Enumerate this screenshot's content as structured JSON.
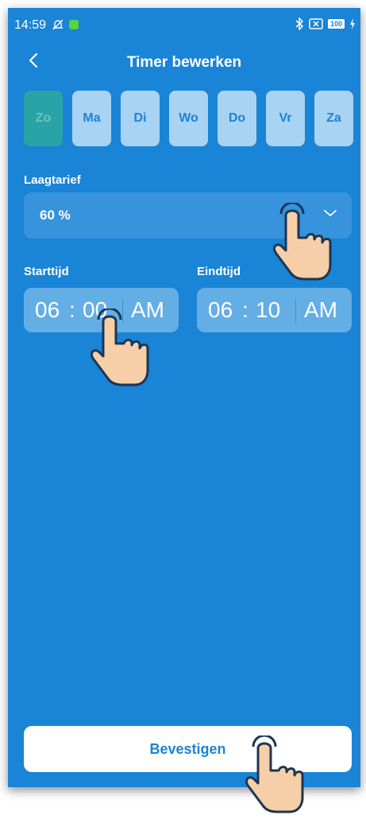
{
  "status_bar": {
    "time": "14:59",
    "battery": "100",
    "icons": [
      "muted-notification-icon",
      "app-notification-icon",
      "bluetooth-icon",
      "no-sim-icon",
      "battery-icon",
      "charging-icon"
    ]
  },
  "header": {
    "title": "Timer bewerken",
    "back_icon": "chevron-left-icon"
  },
  "days": [
    {
      "label": "Zo",
      "selected": true
    },
    {
      "label": "Ma",
      "selected": false
    },
    {
      "label": "Di",
      "selected": false
    },
    {
      "label": "Wo",
      "selected": false
    },
    {
      "label": "Do",
      "selected": false
    },
    {
      "label": "Vr",
      "selected": false
    },
    {
      "label": "Za",
      "selected": false
    }
  ],
  "tariff": {
    "label": "Laagtarief",
    "value": "60 %"
  },
  "start": {
    "label": "Starttijd",
    "hh": "06",
    "sep": ":",
    "mm": "00",
    "ampm": "AM"
  },
  "end": {
    "label": "Eindtijd",
    "hh": "06",
    "sep": ":",
    "mm": "10",
    "ampm": "AM"
  },
  "confirm_label": "Bevestigen",
  "colors": {
    "background": "#1a84d6",
    "day_tile": "#a9d3f3",
    "day_selected": "#2aa3a6",
    "field": "#3693dc",
    "time_field": "#64aee6",
    "button": "#ffffff",
    "skin": "#f6cfa8"
  }
}
